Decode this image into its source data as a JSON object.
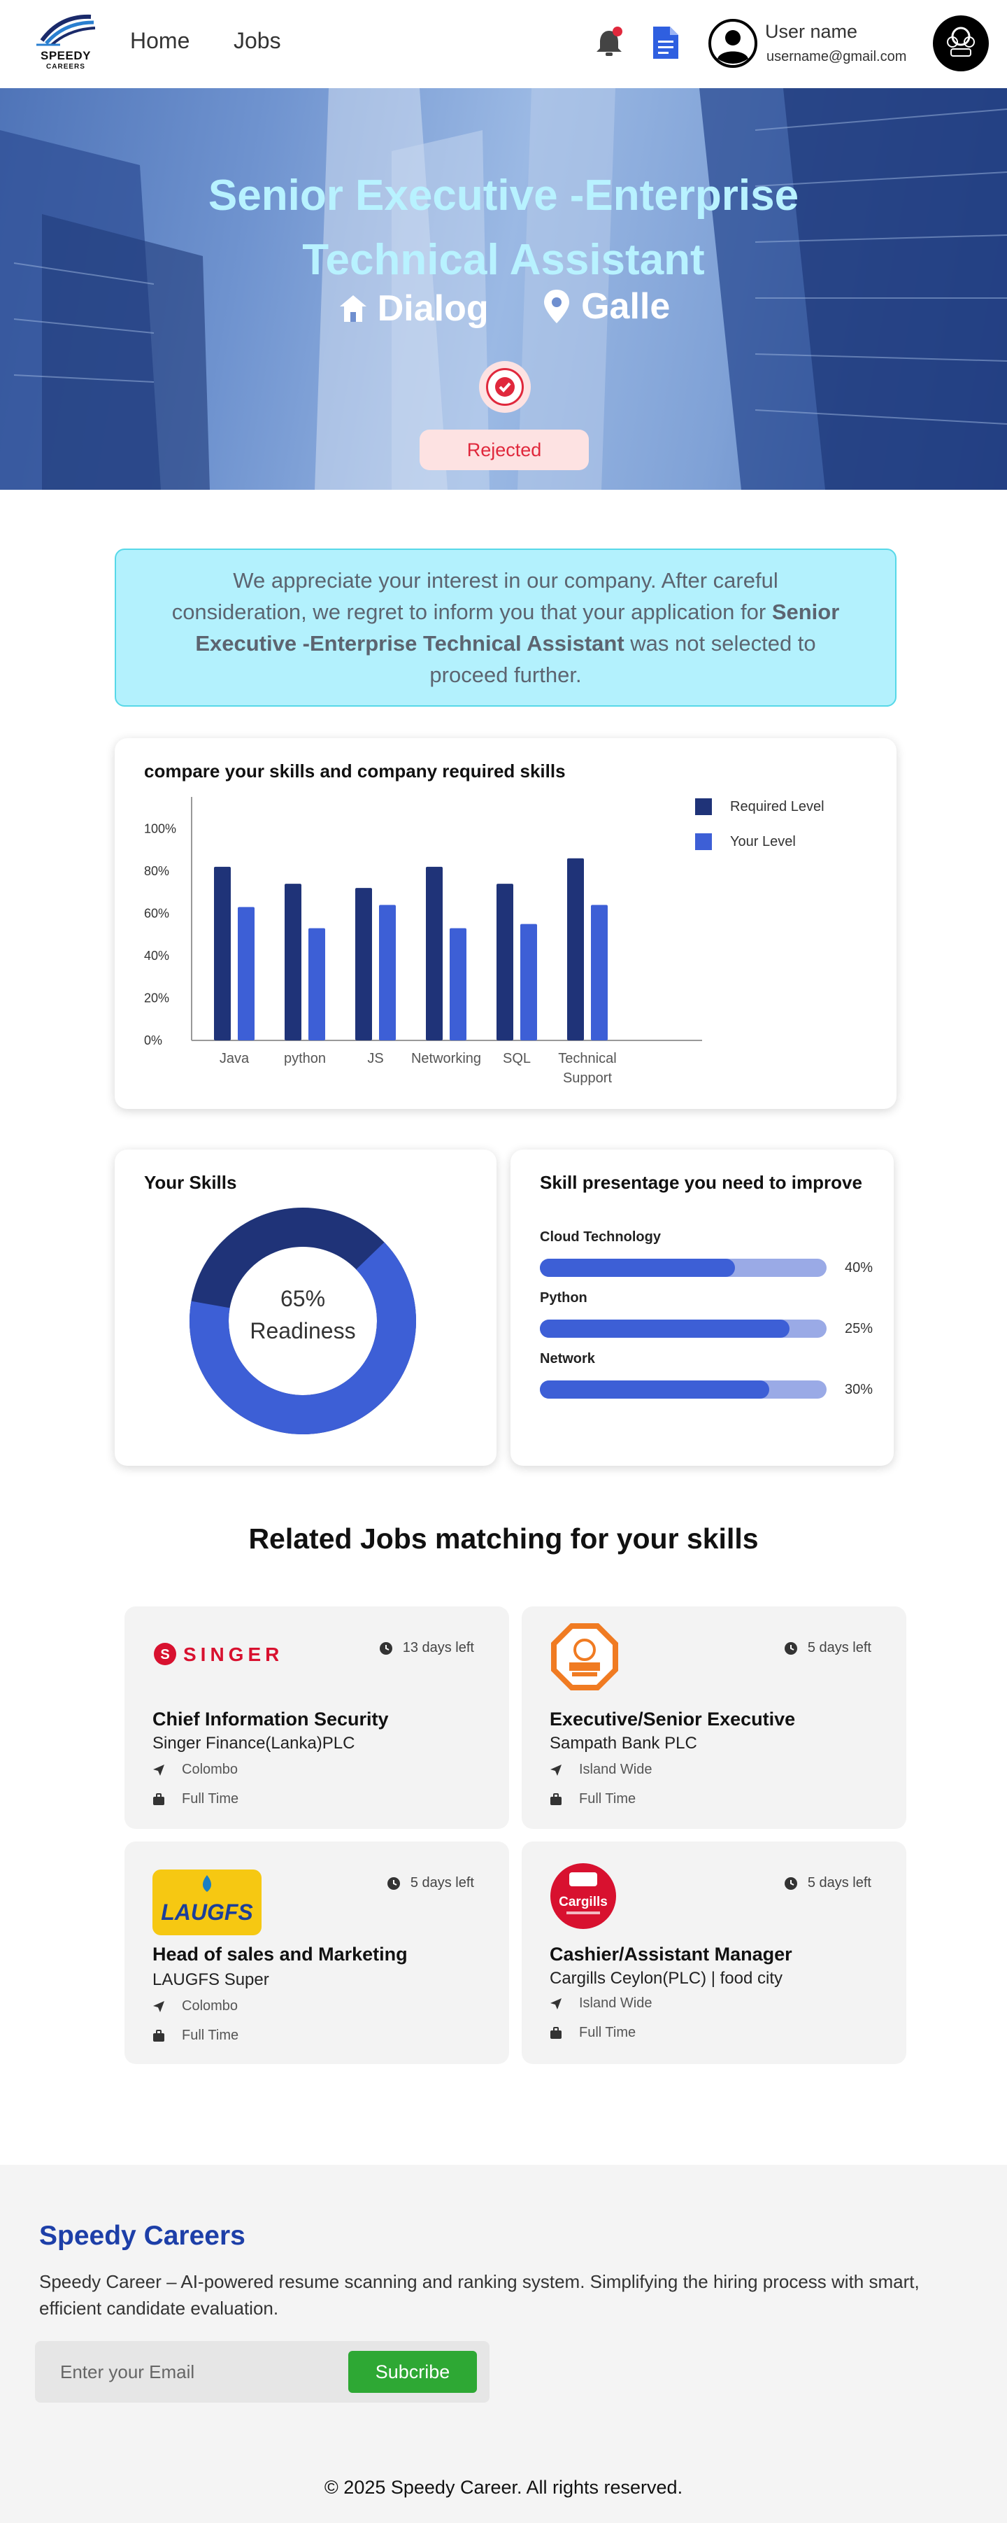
{
  "header": {
    "logo_text": "SPEEDY",
    "logo_subtext": "CAREERS",
    "nav": [
      "Home",
      "Jobs"
    ],
    "user_name": "User name",
    "user_email": "username@gmail.com"
  },
  "hero": {
    "title_line1": "Senior Executive -Enterprise",
    "title_line2": "Technical Assistant",
    "company": "Dialog",
    "location": "Galle",
    "status": "Rejected"
  },
  "message": {
    "before": "We appreciate your interest in our company. After careful consideration, we regret to inform you that your application for",
    "job": "Senior Executive -Enterprise  Technical Assistant",
    "after": "was not selected to proceed further."
  },
  "compare_card": {
    "title": "compare your skills and company required skills"
  },
  "chart_data": {
    "type": "bar",
    "categories": [
      "Java",
      "python",
      "JS",
      "Networking",
      "SQL",
      "Technical Support"
    ],
    "series": [
      {
        "name": "Required Level",
        "values": [
          82,
          74,
          72,
          82,
          74,
          86
        ],
        "color": "#1f3378"
      },
      {
        "name": "Your Level",
        "values": [
          63,
          53,
          64,
          53,
          55,
          64
        ],
        "color": "#3d5fd6"
      }
    ],
    "yticks": [
      "0%",
      "20%",
      "40%",
      "60%",
      "80%",
      "100%"
    ],
    "ylim": [
      0,
      115
    ],
    "grid": false,
    "legend": "top-right"
  },
  "skills_card": {
    "title": "Your Skills",
    "value": "65%",
    "label": "Readiness",
    "readiness": 0.65
  },
  "improve_card": {
    "title": "Skill presentage you need to improve",
    "items": [
      {
        "label": "Cloud Technology",
        "pct": "40%",
        "fill": 0.68
      },
      {
        "label": "Python",
        "pct": "25%",
        "fill": 0.87
      },
      {
        "label": "Network",
        "pct": "30%",
        "fill": 0.8
      }
    ]
  },
  "related": {
    "title": "Related Jobs matching for your skills",
    "jobs": [
      {
        "days": "13 days left",
        "title": "Chief Information Security",
        "company": "Singer Finance(Lanka)PLC",
        "location": "Colombo",
        "type": "Full Time",
        "logo": "singer-logo"
      },
      {
        "days": "5 days left",
        "title": "Executive/Senior Executive",
        "company": "Sampath Bank PLC",
        "location": "Island Wide",
        "type": "Full Time",
        "logo": "sampath-logo"
      },
      {
        "days": "5 days left",
        "title": "Head of sales and Marketing",
        "company": "LAUGFS Super",
        "location": "Colombo",
        "type": "Full Time",
        "logo": "laugfs-logo"
      },
      {
        "days": "5 days left",
        "title": "Cashier/Assistant Manager",
        "company": "Cargills Ceylon(PLC) | food city",
        "location": "Island Wide",
        "type": "Full Time",
        "logo": "cargills-logo"
      }
    ]
  },
  "logos": {
    "singer": "SINGER",
    "laugfs": "LAUGFS",
    "cargills": "Cargills"
  },
  "footer": {
    "title": "Speedy Careers",
    "description": "Speedy Career – AI-powered resume scanning and ranking system. Simplifying the hiring process with smart, efficient candidate evaluation.",
    "email_placeholder": "Enter your Email",
    "subscribe_label": "Subcribe",
    "copyright": "© 2025 Speedy Career. All rights reserved."
  },
  "colors": {
    "primary_dark": "#1f3378",
    "primary": "#3d5fd6",
    "rejected": "#e0283c",
    "message_bg": "#b3f1fd",
    "footer_title": "#1d3fa8",
    "subscribe": "#2ea834"
  }
}
